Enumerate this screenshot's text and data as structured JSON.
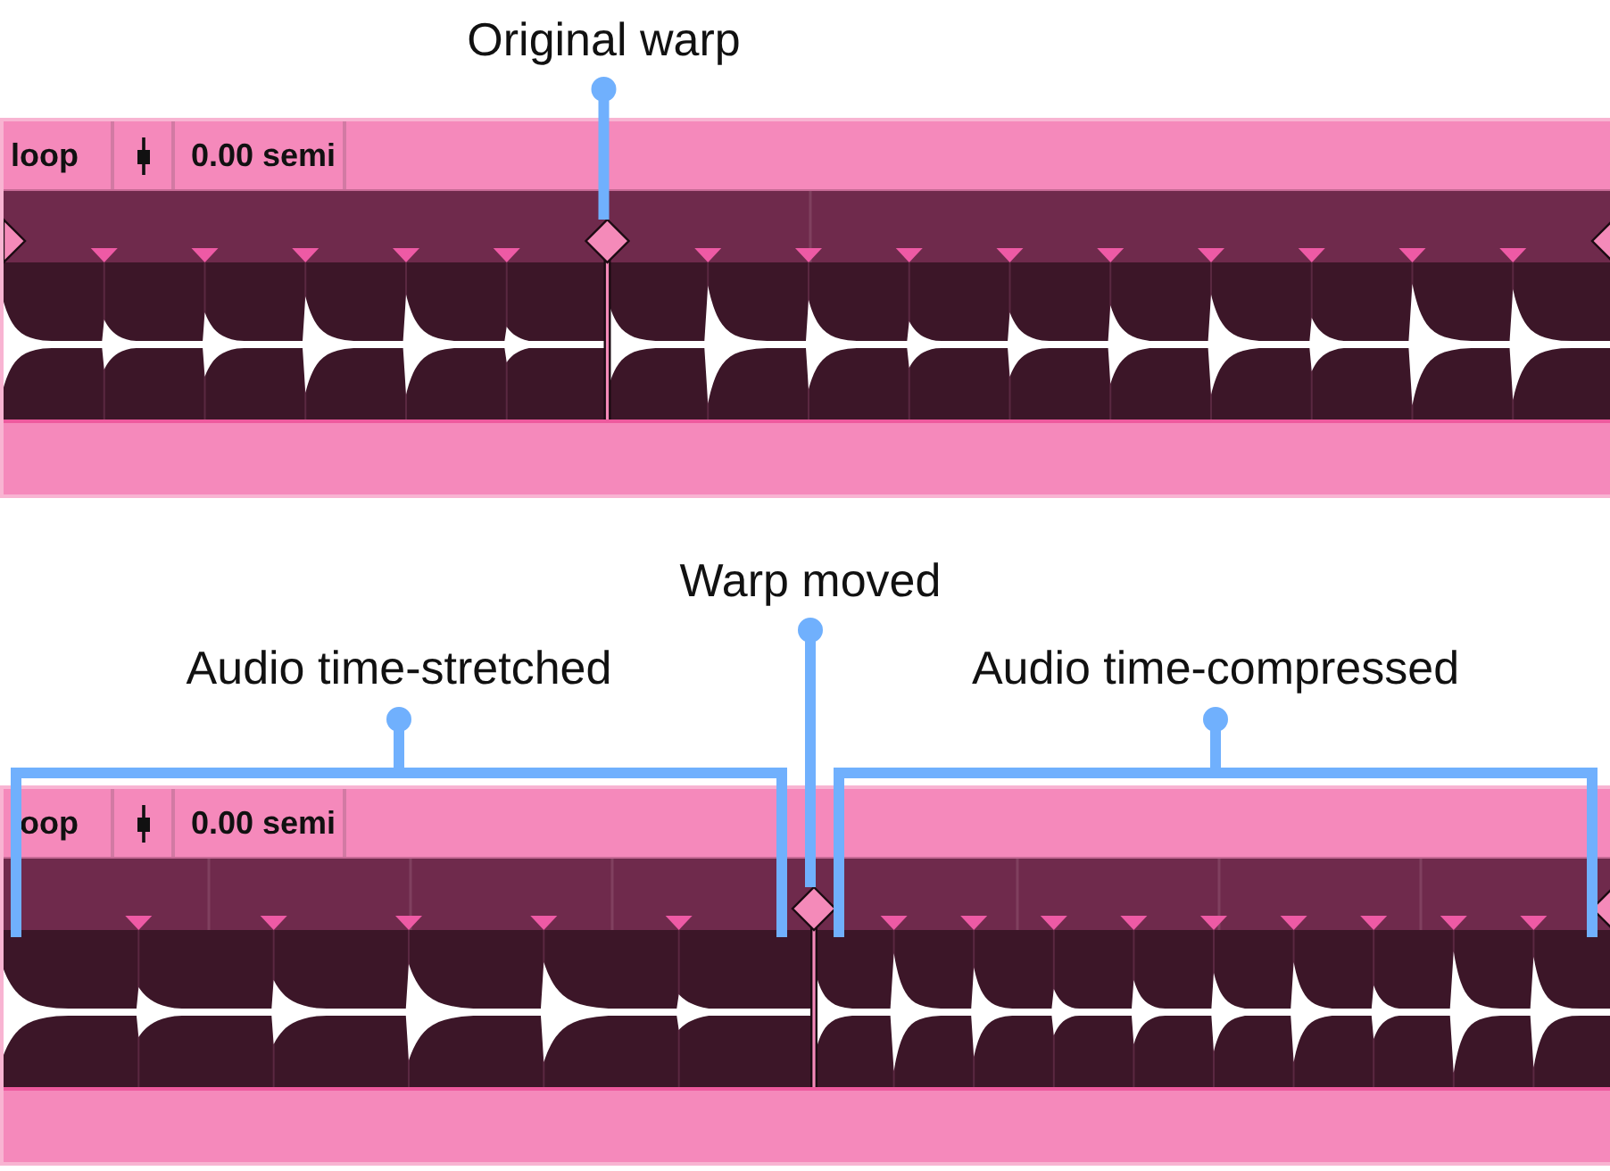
{
  "panels": [
    {
      "callouts": [
        {
          "kind": "pin",
          "label": "Original warp"
        }
      ],
      "clip": {
        "name": "loop",
        "transpose": "0.00 semi"
      }
    },
    {
      "callouts": [
        {
          "kind": "pin",
          "label": "Warp moved"
        },
        {
          "kind": "bracket",
          "label": "Audio time-stretched"
        },
        {
          "kind": "bracket",
          "label": "Audio time-compressed"
        }
      ],
      "clip": {
        "name": "oop",
        "transpose": "0.00 semi"
      }
    }
  ]
}
